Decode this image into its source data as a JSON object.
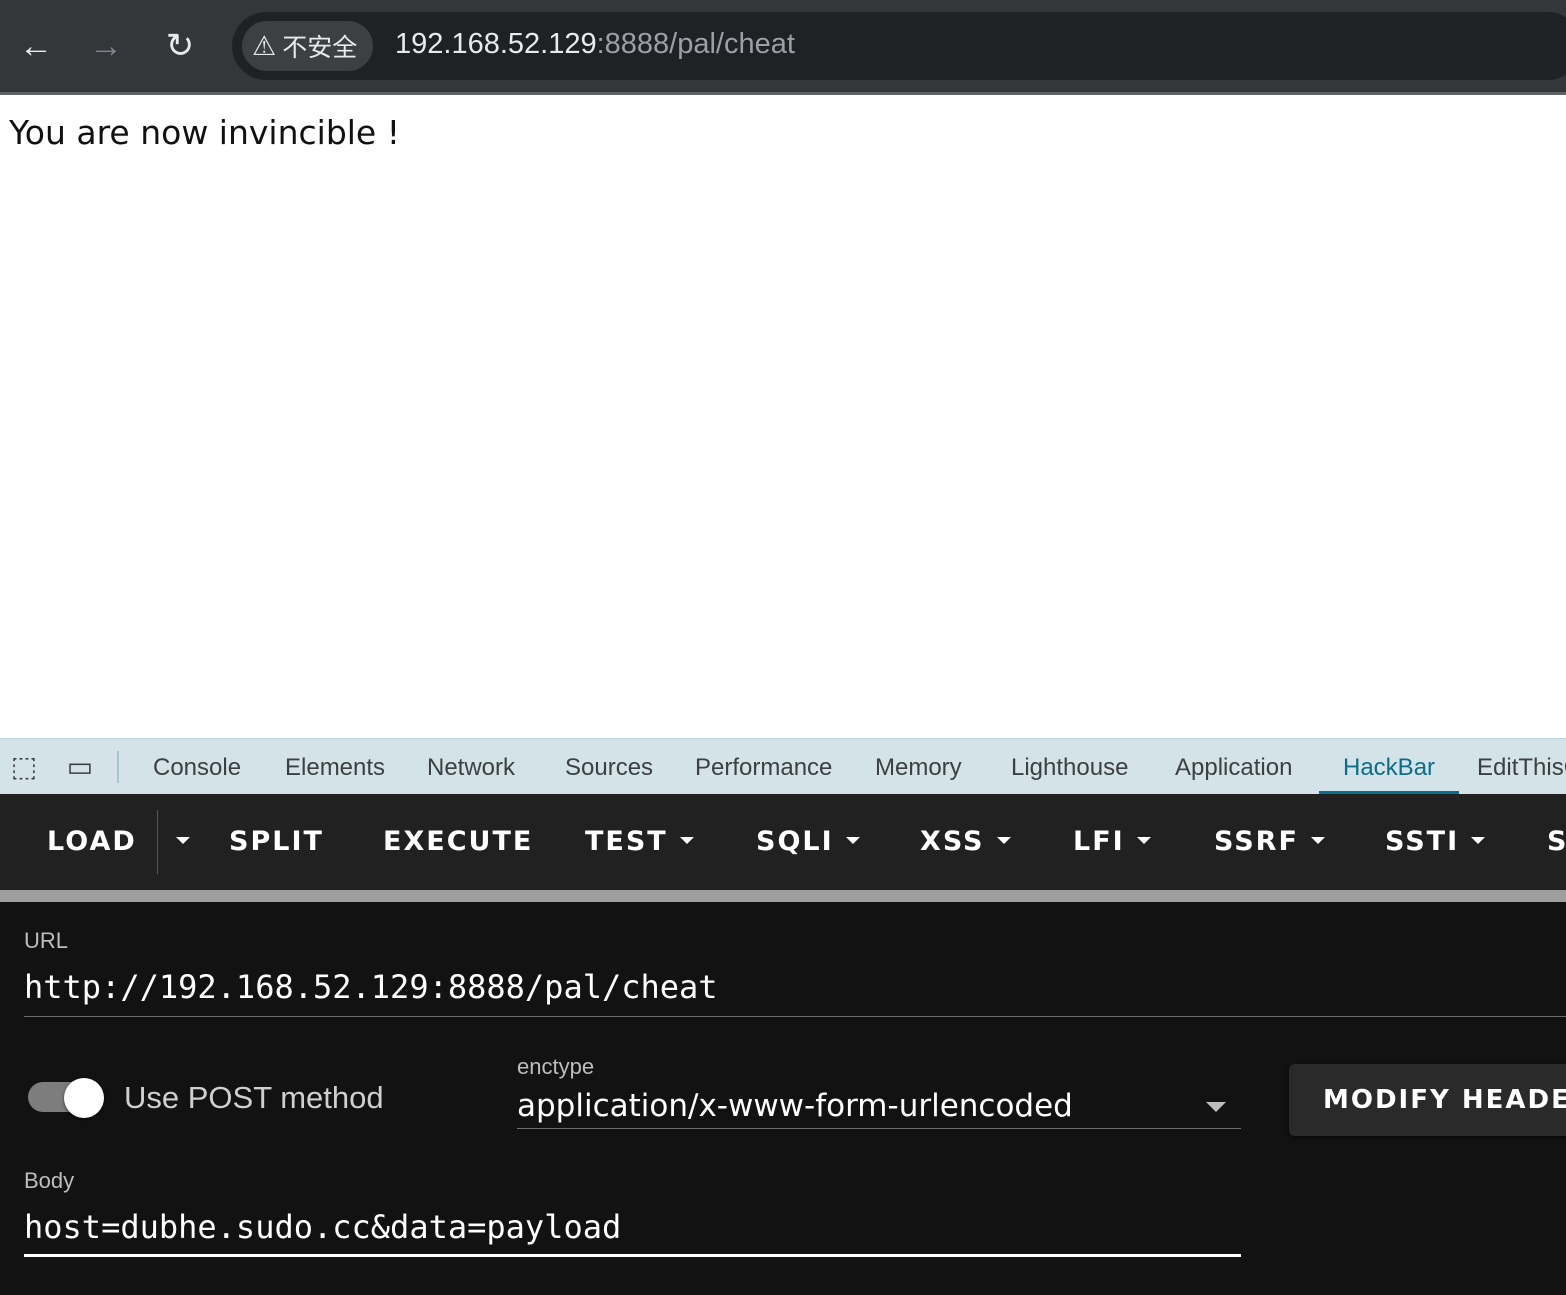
{
  "browser": {
    "back_icon": "←",
    "forward_icon": "→",
    "reload_icon": "↻",
    "security_chip": {
      "icon": "⚠",
      "label": "不安全"
    },
    "url_host": "192.168.52.129",
    "url_rest": ":8888/pal/cheat"
  },
  "page": {
    "message": "You are now invincible !"
  },
  "devtools": {
    "tabs": [
      "Console",
      "Elements",
      "Network",
      "Sources",
      "Performance",
      "Memory",
      "Lighthouse",
      "Application",
      "HackBar",
      "EditThisC"
    ],
    "active_tab": "HackBar"
  },
  "hackbar": {
    "toolbar": {
      "load": "LOAD",
      "split": "SPLIT",
      "execute": "EXECUTE",
      "test": "TEST",
      "sqli": "SQLI",
      "xss": "XSS",
      "lfi": "LFI",
      "ssrf": "SSRF",
      "ssti": "SSTI",
      "more": "S"
    },
    "url_label": "URL",
    "url_value": "http://192.168.52.129:8888/pal/cheat",
    "post_toggle": {
      "label": "Use POST method",
      "on": true
    },
    "enctype_label": "enctype",
    "enctype_value": "application/x-www-form-urlencoded",
    "modify_header": "MODIFY HEADER",
    "body_label": "Body",
    "body_value": "host=dubhe.sudo.cc&data=payload"
  }
}
